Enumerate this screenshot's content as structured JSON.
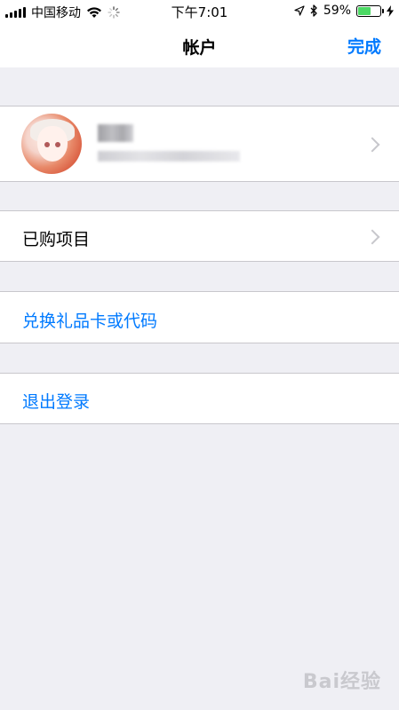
{
  "status_bar": {
    "carrier": "中国移动",
    "time": "下午7:01",
    "battery_percent": "59%",
    "battery_level": 0.59
  },
  "nav": {
    "title": "帐户",
    "done_label": "完成"
  },
  "rows": {
    "purchased": "已购项目",
    "redeem": "兑换礼品卡或代码",
    "sign_out": "退出登录"
  },
  "watermark": "Bai经验",
  "colors": {
    "accent": "#007aff",
    "background": "#efeff4",
    "battery": "#4cd964"
  }
}
